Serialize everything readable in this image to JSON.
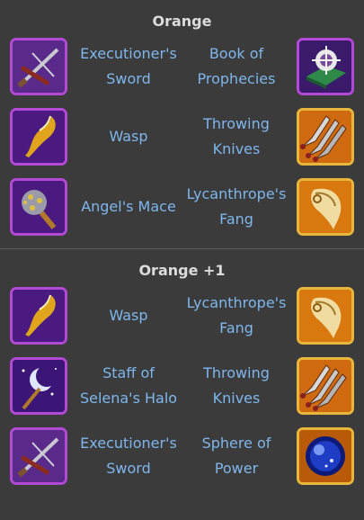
{
  "sections": [
    {
      "title": "Orange",
      "rows": [
        {
          "left": {
            "name": "Executioner's Sword",
            "icon": "sword-crossbow-icon",
            "frame": "purple"
          },
          "right": {
            "name": "Book of Prophecies",
            "icon": "book-icon",
            "frame": "purple"
          }
        },
        {
          "left": {
            "name": "Wasp",
            "icon": "horn-icon",
            "frame": "purple"
          },
          "right": {
            "name": "Throwing Knives",
            "icon": "knives-icon",
            "frame": "gold"
          }
        },
        {
          "left": {
            "name": "Angel's Mace",
            "icon": "mace-icon",
            "frame": "purple"
          },
          "right": {
            "name": "Lycanthrope's Fang",
            "icon": "fang-icon",
            "frame": "gold"
          }
        }
      ]
    },
    {
      "title": "Orange +1",
      "rows": [
        {
          "left": {
            "name": "Wasp",
            "icon": "horn-icon",
            "frame": "purple"
          },
          "right": {
            "name": "Lycanthrope's Fang",
            "icon": "fang-icon",
            "frame": "gold"
          }
        },
        {
          "left": {
            "name": "Staff of Selena's Halo",
            "icon": "moon-staff-icon",
            "frame": "purple"
          },
          "right": {
            "name": "Throwing Knives",
            "icon": "knives-icon",
            "frame": "gold"
          }
        },
        {
          "left": {
            "name": "Executioner's Sword",
            "icon": "sword-crossbow-icon",
            "frame": "purple"
          },
          "right": {
            "name": "Sphere of Power",
            "icon": "sphere-icon",
            "frame": "gold"
          }
        }
      ]
    }
  ],
  "colors": {
    "background": "#3b3b3b",
    "title": "#dcdcdc",
    "item_name": "#7fb6ec",
    "purple_frame": "#b24ad6",
    "gold_frame": "#e7b63a"
  }
}
